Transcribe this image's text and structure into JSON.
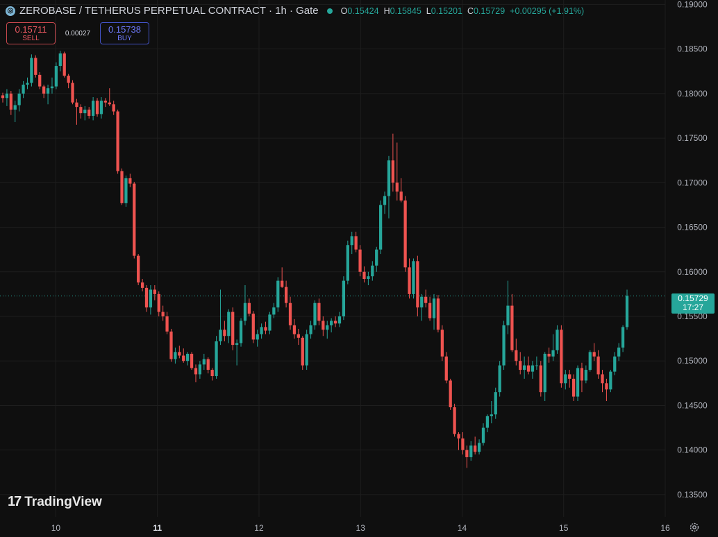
{
  "header": {
    "symbol": "ZEROBASE / TETHERUS PERPETUAL CONTRACT · 1h · Gate",
    "ohlc": {
      "o_label": "O",
      "o": "0.15424",
      "h_label": "H",
      "h": "0.15845",
      "l_label": "L",
      "l": "0.15201",
      "c_label": "C",
      "c": "0.15729",
      "change": "+0.00295 (+1.91%)"
    }
  },
  "trade": {
    "sell_price": "0.15711",
    "sell_label": "SELL",
    "spread": "0.00027",
    "buy_price": "0.15738",
    "buy_label": "BUY"
  },
  "logo": {
    "text": "TradingView"
  },
  "last_price": {
    "value": "0.15729",
    "countdown": "17:27"
  },
  "colors": {
    "up": "#26a69a",
    "down": "#ef5350",
    "background": "#0f0f0f",
    "grid": "#1e1e1e"
  },
  "chart_data": {
    "type": "candlestick",
    "y_ticks": [
      "0.19000",
      "0.18500",
      "0.18000",
      "0.17500",
      "0.17000",
      "0.16500",
      "0.16000",
      "0.15500",
      "0.15000",
      "0.14500",
      "0.14000",
      "0.13500"
    ],
    "x_ticks": [
      {
        "label": "10",
        "x": 10,
        "bold": false
      },
      {
        "label": "11",
        "x": 11,
        "bold": true
      },
      {
        "label": "12",
        "x": 12,
        "bold": false
      },
      {
        "label": "13",
        "x": 13,
        "bold": false
      },
      {
        "label": "14",
        "x": 14,
        "bold": false
      },
      {
        "label": "15",
        "x": 15,
        "bold": false
      },
      {
        "label": "16",
        "x": 16,
        "bold": false
      }
    ],
    "ylim": [
      0.1325,
      0.1905
    ],
    "xlim": [
      9.45,
      16.0
    ],
    "last_price": 0.15729,
    "candles": [
      [
        0.1798,
        0.1801,
        0.179,
        0.1795
      ],
      [
        0.1795,
        0.1805,
        0.1786,
        0.18
      ],
      [
        0.18,
        0.1803,
        0.1776,
        0.1782
      ],
      [
        0.1782,
        0.1792,
        0.1768,
        0.1787
      ],
      [
        0.1787,
        0.1805,
        0.178,
        0.18
      ],
      [
        0.18,
        0.1814,
        0.1795,
        0.181
      ],
      [
        0.181,
        0.1818,
        0.1805,
        0.1812
      ],
      [
        0.1812,
        0.1844,
        0.1808,
        0.184
      ],
      [
        0.184,
        0.1843,
        0.1818,
        0.1821
      ],
      [
        0.1821,
        0.1824,
        0.1805,
        0.1808
      ],
      [
        0.1808,
        0.181,
        0.1795,
        0.18
      ],
      [
        0.18,
        0.181,
        0.1788,
        0.1806
      ],
      [
        0.1806,
        0.1818,
        0.18,
        0.1808
      ],
      [
        0.1808,
        0.1835,
        0.1805,
        0.1831
      ],
      [
        0.1831,
        0.1848,
        0.1825,
        0.1845
      ],
      [
        0.1845,
        0.1847,
        0.1818,
        0.182
      ],
      [
        0.182,
        0.1822,
        0.1806,
        0.1812
      ],
      [
        0.1812,
        0.1815,
        0.1788,
        0.179
      ],
      [
        0.179,
        0.1794,
        0.1765,
        0.1785
      ],
      [
        0.1785,
        0.1788,
        0.1772,
        0.1778
      ],
      [
        0.1778,
        0.1786,
        0.177,
        0.1782
      ],
      [
        0.1782,
        0.1785,
        0.1772,
        0.1775
      ],
      [
        0.1775,
        0.1796,
        0.177,
        0.1792
      ],
      [
        0.1792,
        0.1795,
        0.1774,
        0.1777
      ],
      [
        0.1777,
        0.1796,
        0.1772,
        0.1792
      ],
      [
        0.1792,
        0.1795,
        0.1785,
        0.179
      ],
      [
        0.179,
        0.1806,
        0.1786,
        0.1788
      ],
      [
        0.1788,
        0.1792,
        0.1776,
        0.178
      ],
      [
        0.178,
        0.1782,
        0.171,
        0.1713
      ],
      [
        0.1713,
        0.1716,
        0.1675,
        0.1677
      ],
      [
        0.1677,
        0.1708,
        0.1673,
        0.1705
      ],
      [
        0.1705,
        0.171,
        0.1695,
        0.1699
      ],
      [
        0.1699,
        0.1701,
        0.1615,
        0.1618
      ],
      [
        0.1618,
        0.162,
        0.1585,
        0.1588
      ],
      [
        0.1588,
        0.1592,
        0.1578,
        0.1582
      ],
      [
        0.1582,
        0.1585,
        0.1555,
        0.156
      ],
      [
        0.156,
        0.1585,
        0.1552,
        0.158
      ],
      [
        0.158,
        0.1585,
        0.1568,
        0.1575
      ],
      [
        0.1575,
        0.1578,
        0.155,
        0.1555
      ],
      [
        0.1555,
        0.1562,
        0.1545,
        0.155
      ],
      [
        0.155,
        0.1555,
        0.153,
        0.1533
      ],
      [
        0.1533,
        0.1536,
        0.1499,
        0.1502
      ],
      [
        0.1502,
        0.1515,
        0.1497,
        0.151
      ],
      [
        0.151,
        0.1517,
        0.1503,
        0.1506
      ],
      [
        0.1506,
        0.1514,
        0.1498,
        0.15
      ],
      [
        0.15,
        0.151,
        0.1495,
        0.1508
      ],
      [
        0.1508,
        0.151,
        0.149,
        0.1492
      ],
      [
        0.1492,
        0.1496,
        0.1476,
        0.1485
      ],
      [
        0.1485,
        0.15,
        0.148,
        0.1496
      ],
      [
        0.1496,
        0.1508,
        0.149,
        0.1502
      ],
      [
        0.1502,
        0.1504,
        0.1486,
        0.149
      ],
      [
        0.149,
        0.1492,
        0.1478,
        0.1483
      ],
      [
        0.1483,
        0.1528,
        0.148,
        0.1522
      ],
      [
        0.1522,
        0.158,
        0.1518,
        0.1535
      ],
      [
        0.1535,
        0.1545,
        0.1522,
        0.1528
      ],
      [
        0.1528,
        0.1558,
        0.152,
        0.1555
      ],
      [
        0.1555,
        0.156,
        0.1512,
        0.1518
      ],
      [
        0.1518,
        0.1524,
        0.1495,
        0.152
      ],
      [
        0.152,
        0.1548,
        0.1516,
        0.1545
      ],
      [
        0.1545,
        0.1585,
        0.154,
        0.1565
      ],
      [
        0.1565,
        0.157,
        0.155,
        0.1553
      ],
      [
        0.1553,
        0.1556,
        0.152,
        0.1524
      ],
      [
        0.1524,
        0.1535,
        0.1516,
        0.153
      ],
      [
        0.153,
        0.1542,
        0.1525,
        0.1538
      ],
      [
        0.1538,
        0.1544,
        0.153,
        0.1534
      ],
      [
        0.1534,
        0.1555,
        0.153,
        0.1552
      ],
      [
        0.1552,
        0.1565,
        0.1548,
        0.156
      ],
      [
        0.156,
        0.1594,
        0.1555,
        0.159
      ],
      [
        0.159,
        0.1605,
        0.1582,
        0.1583
      ],
      [
        0.1583,
        0.159,
        0.156,
        0.1565
      ],
      [
        0.1565,
        0.1572,
        0.1535,
        0.154
      ],
      [
        0.154,
        0.1547,
        0.1525,
        0.153
      ],
      [
        0.153,
        0.1536,
        0.1518,
        0.1526
      ],
      [
        0.1526,
        0.1528,
        0.149,
        0.1495
      ],
      [
        0.1495,
        0.1535,
        0.149,
        0.153
      ],
      [
        0.153,
        0.1545,
        0.1525,
        0.154
      ],
      [
        0.154,
        0.1568,
        0.1535,
        0.1565
      ],
      [
        0.1565,
        0.157,
        0.154,
        0.1545
      ],
      [
        0.1545,
        0.155,
        0.1528,
        0.1535
      ],
      [
        0.1535,
        0.1545,
        0.1525,
        0.154
      ],
      [
        0.154,
        0.1548,
        0.1532,
        0.1545
      ],
      [
        0.1545,
        0.155,
        0.1538,
        0.1542
      ],
      [
        0.1542,
        0.1555,
        0.1538,
        0.155
      ],
      [
        0.155,
        0.1595,
        0.1546,
        0.159
      ],
      [
        0.159,
        0.1635,
        0.1586,
        0.163
      ],
      [
        0.163,
        0.1645,
        0.162,
        0.164
      ],
      [
        0.164,
        0.1645,
        0.1622,
        0.1625
      ],
      [
        0.1625,
        0.163,
        0.1595,
        0.16
      ],
      [
        0.16,
        0.1606,
        0.1588,
        0.1592
      ],
      [
        0.1592,
        0.16,
        0.1585,
        0.1595
      ],
      [
        0.1595,
        0.1612,
        0.159,
        0.1607
      ],
      [
        0.1607,
        0.1628,
        0.16,
        0.1625
      ],
      [
        0.1625,
        0.168,
        0.162,
        0.1675
      ],
      [
        0.1675,
        0.169,
        0.1665,
        0.1685
      ],
      [
        0.1685,
        0.173,
        0.166,
        0.1725
      ],
      [
        0.1725,
        0.1755,
        0.169,
        0.17
      ],
      [
        0.17,
        0.1745,
        0.168,
        0.169
      ],
      [
        0.169,
        0.1705,
        0.1678,
        0.168
      ],
      [
        0.168,
        0.1685,
        0.16,
        0.1605
      ],
      [
        0.1605,
        0.1615,
        0.157,
        0.1575
      ],
      [
        0.1575,
        0.1615,
        0.157,
        0.1612
      ],
      [
        0.1612,
        0.1618,
        0.155,
        0.156
      ],
      [
        0.156,
        0.1575,
        0.1545,
        0.1572
      ],
      [
        0.1572,
        0.158,
        0.156,
        0.1565
      ],
      [
        0.1565,
        0.1572,
        0.1545,
        0.1548
      ],
      [
        0.1548,
        0.1575,
        0.1535,
        0.157
      ],
      [
        0.157,
        0.1574,
        0.1532,
        0.1535
      ],
      [
        0.1535,
        0.154,
        0.15,
        0.1505
      ],
      [
        0.1505,
        0.151,
        0.1475,
        0.1478
      ],
      [
        0.1478,
        0.148,
        0.1445,
        0.1448
      ],
      [
        0.1448,
        0.1452,
        0.1415,
        0.1418
      ],
      [
        0.1418,
        0.142,
        0.14,
        0.1413
      ],
      [
        0.1413,
        0.142,
        0.1395,
        0.14
      ],
      [
        0.14,
        0.1405,
        0.138,
        0.1392
      ],
      [
        0.1392,
        0.141,
        0.1388,
        0.1405
      ],
      [
        0.1405,
        0.1415,
        0.1395,
        0.1398
      ],
      [
        0.1398,
        0.1412,
        0.1395,
        0.1408
      ],
      [
        0.1408,
        0.143,
        0.1405,
        0.1425
      ],
      [
        0.1425,
        0.144,
        0.142,
        0.1438
      ],
      [
        0.1438,
        0.1455,
        0.143,
        0.144
      ],
      [
        0.144,
        0.147,
        0.1435,
        0.1465
      ],
      [
        0.1465,
        0.15,
        0.146,
        0.1495
      ],
      [
        0.1495,
        0.1545,
        0.149,
        0.154
      ],
      [
        0.154,
        0.159,
        0.153,
        0.1562
      ],
      [
        0.1562,
        0.1575,
        0.151,
        0.1512
      ],
      [
        0.1512,
        0.1525,
        0.1495,
        0.15
      ],
      [
        0.15,
        0.151,
        0.1485,
        0.149
      ],
      [
        0.149,
        0.1505,
        0.148,
        0.1495
      ],
      [
        0.1495,
        0.1505,
        0.1485,
        0.1488
      ],
      [
        0.1488,
        0.15,
        0.148,
        0.1495
      ],
      [
        0.1495,
        0.1505,
        0.149,
        0.1495
      ],
      [
        0.1495,
        0.15,
        0.146,
        0.1465
      ],
      [
        0.1465,
        0.151,
        0.1455,
        0.1508
      ],
      [
        0.1508,
        0.1515,
        0.1498,
        0.1505
      ],
      [
        0.1505,
        0.153,
        0.15,
        0.1512
      ],
      [
        0.1512,
        0.154,
        0.1508,
        0.1535
      ],
      [
        0.1535,
        0.154,
        0.147,
        0.1475
      ],
      [
        0.1475,
        0.149,
        0.1468,
        0.1485
      ],
      [
        0.1485,
        0.149,
        0.147,
        0.148
      ],
      [
        0.148,
        0.1485,
        0.1455,
        0.146
      ],
      [
        0.146,
        0.1495,
        0.1455,
        0.1492
      ],
      [
        0.1492,
        0.1498,
        0.1465,
        0.1478
      ],
      [
        0.1478,
        0.1495,
        0.1475,
        0.149
      ],
      [
        0.149,
        0.1512,
        0.1488,
        0.151
      ],
      [
        0.151,
        0.152,
        0.15,
        0.1505
      ],
      [
        0.1505,
        0.1512,
        0.148,
        0.1485
      ],
      [
        0.1485,
        0.149,
        0.1465,
        0.1475
      ],
      [
        0.1475,
        0.148,
        0.1455,
        0.1468
      ],
      [
        0.1468,
        0.149,
        0.1465,
        0.1488
      ],
      [
        0.1488,
        0.151,
        0.1484,
        0.1505
      ],
      [
        0.1505,
        0.152,
        0.15,
        0.1515
      ],
      [
        0.1515,
        0.154,
        0.151,
        0.1538
      ],
      [
        0.1538,
        0.158,
        0.1535,
        0.1573
      ]
    ]
  }
}
